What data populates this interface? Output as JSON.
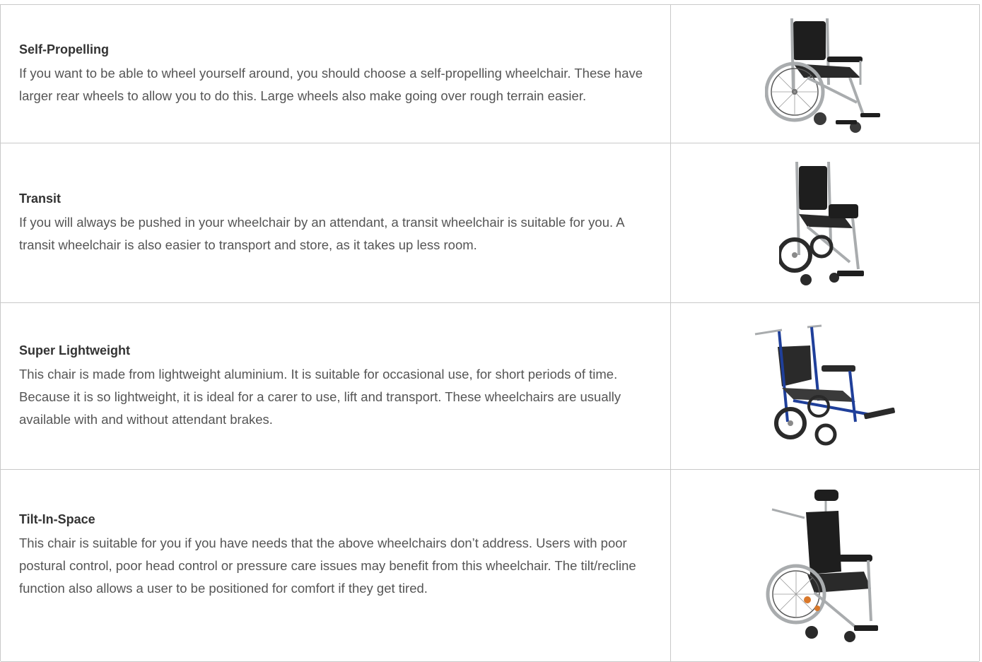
{
  "rows": [
    {
      "title": "Self-Propelling",
      "description": "If you want to be able to wheel yourself around, you should choose a self-propelling wheelchair. These have larger rear wheels to allow you to do this. Large wheels also make going over rough terrain easier.",
      "image_icon": "self-propelling-wheelchair-icon"
    },
    {
      "title": "Transit",
      "description": "If you will always be pushed in your wheelchair by an attendant, a transit wheelchair is suitable for you. A transit wheelchair is also easier to transport and store, as it takes up less room.",
      "image_icon": "transit-wheelchair-icon"
    },
    {
      "title": "Super Lightweight",
      "description": "This chair is made from lightweight aluminium. It is suitable for occasional use, for short periods of time. Because it is so lightweight, it is ideal for a carer to use, lift and transport. These wheelchairs are usually available with and without attendant brakes.",
      "image_icon": "lightweight-wheelchair-icon"
    },
    {
      "title": "Tilt-In-Space",
      "description": "This chair is suitable for you if you have needs that the above wheelchairs don’t address. Users with poor postural control, poor head control or pressure care issues may benefit from this wheelchair. The tilt/recline function also allows a user to be positioned for comfort if they get tired.",
      "image_icon": "tilt-in-space-wheelchair-icon"
    }
  ],
  "colors": {
    "frame_silver": "#a9acae",
    "seat_black": "#1e1e1e",
    "frame_blue": "#1f3f9a",
    "accent_orange": "#d9782a"
  }
}
